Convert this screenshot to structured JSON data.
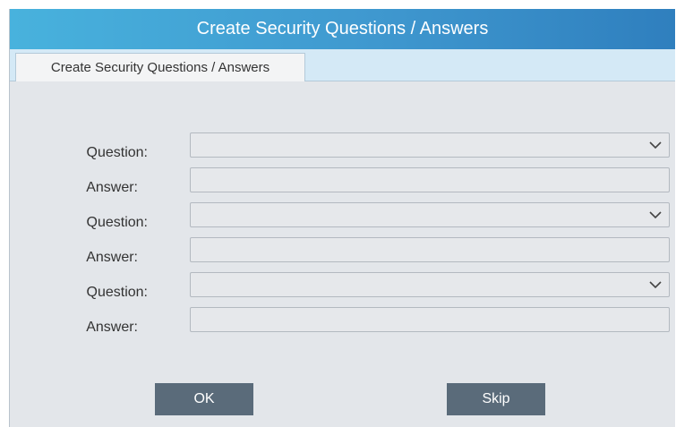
{
  "window": {
    "title": "Create Security Questions / Answers"
  },
  "tabs": [
    {
      "label": "Create Security Questions / Answers",
      "active": true
    }
  ],
  "form": {
    "question_label": "Question:",
    "answer_label": "Answer:",
    "rows": [
      {
        "question": "",
        "answer": ""
      },
      {
        "question": "",
        "answer": ""
      },
      {
        "question": "",
        "answer": ""
      }
    ]
  },
  "buttons": {
    "ok_label": "OK",
    "skip_label": "Skip"
  },
  "colors": {
    "title_bar_start": "#48b2dd",
    "title_bar_end": "#2f7fbe",
    "tab_strip": "#d4e9f6",
    "panel": "#e3e6ea",
    "button": "#5a6b7a"
  },
  "icons": {
    "dropdown": "chevron-down-icon"
  }
}
